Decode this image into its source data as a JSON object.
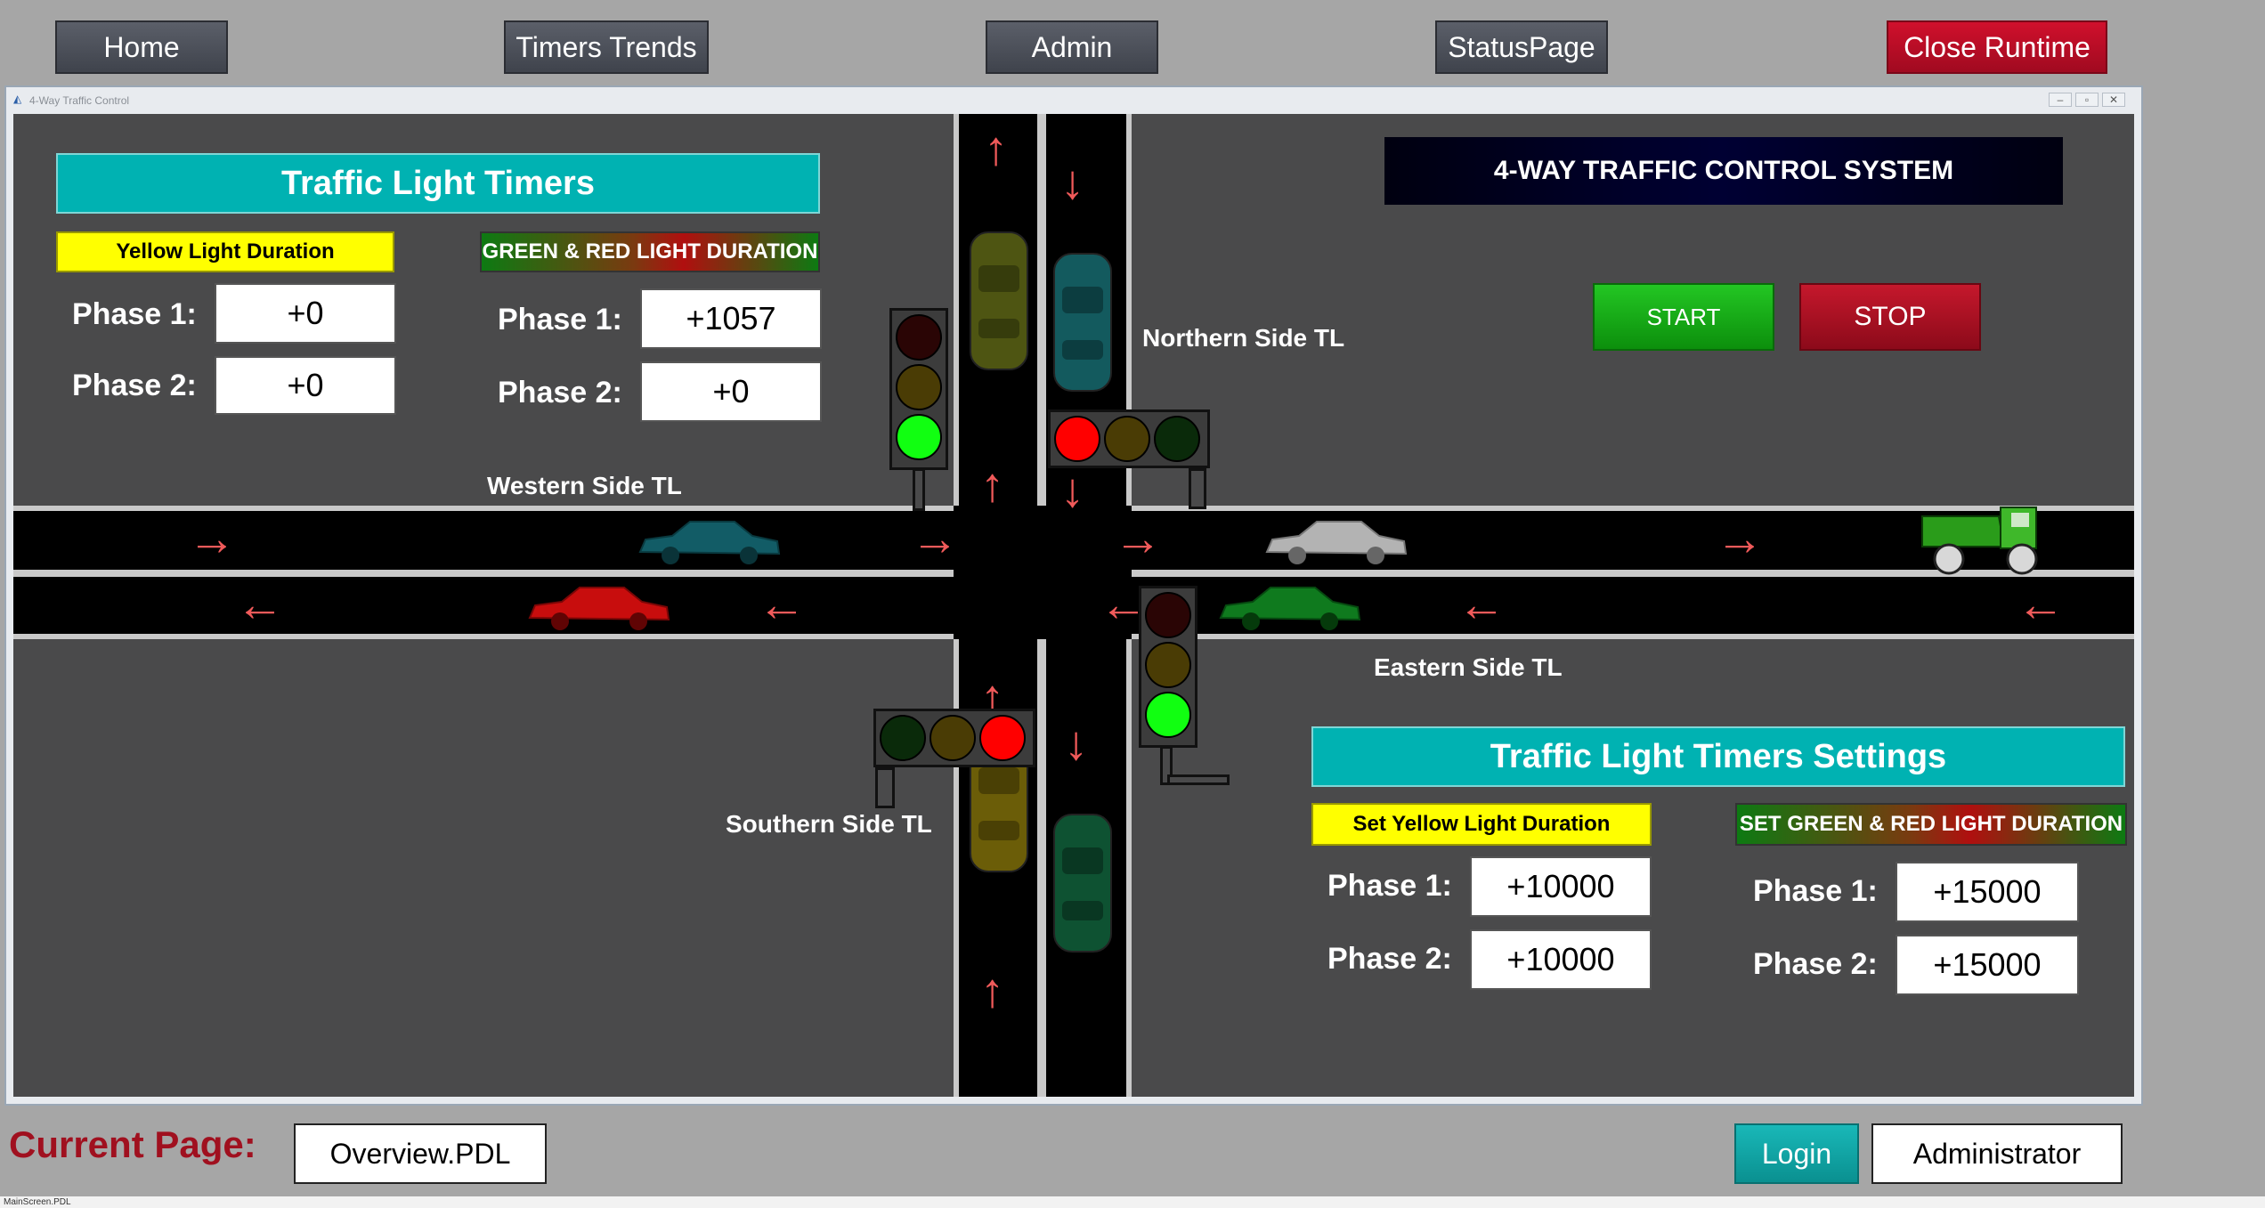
{
  "nav": {
    "home": "Home",
    "timers_trends": "Timers Trends",
    "admin": "Admin",
    "status_page": "StatusPage",
    "close_runtime": "Close Runtime"
  },
  "window": {
    "title": "4-Way Traffic Control",
    "controls": [
      "–",
      "▫",
      "✕"
    ]
  },
  "timers": {
    "header": "Traffic Light Timers",
    "yellow_label": "Yellow Light Duration",
    "gr_label": "GREEN & RED LIGHT DURATION",
    "phase1_label": "Phase 1:",
    "phase2_label": "Phase 2:",
    "yellow_phase1": "+0",
    "yellow_phase2": "+0",
    "gr_phase1": "+1057",
    "gr_phase2": "+0"
  },
  "system": {
    "banner": "4-WAY TRAFFIC CONTROL SYSTEM",
    "start": "START",
    "stop": "STOP"
  },
  "sides": {
    "north": "Northern Side TL",
    "west": "Western Side TL",
    "east": "Eastern Side TL",
    "south": "Southern Side TL"
  },
  "lights": {
    "north": "red",
    "west": "green",
    "east": "green",
    "south": "red",
    "colors": {
      "red_on": "#ff0000",
      "red_off": "#2a0505",
      "yellow_off": "#4a3c05",
      "green_on": "#11ff11",
      "green_off": "#0a2a0a"
    }
  },
  "settings": {
    "header": "Traffic Light Timers Settings",
    "yellow_label": "Set Yellow Light Duration",
    "gr_label": "SET GREEN & RED LIGHT DURATION",
    "phase1_label": "Phase 1:",
    "phase2_label": "Phase 2:",
    "yellow_phase1": "+10000",
    "yellow_phase2": "+10000",
    "gr_phase1": "+15000",
    "gr_phase2": "+15000"
  },
  "footer": {
    "current_page_label": "Current Page:",
    "current_page": "Overview.PDL",
    "login": "Login",
    "user": "Administrator"
  },
  "statusbar": {
    "text": "MainScreen.PDL"
  }
}
